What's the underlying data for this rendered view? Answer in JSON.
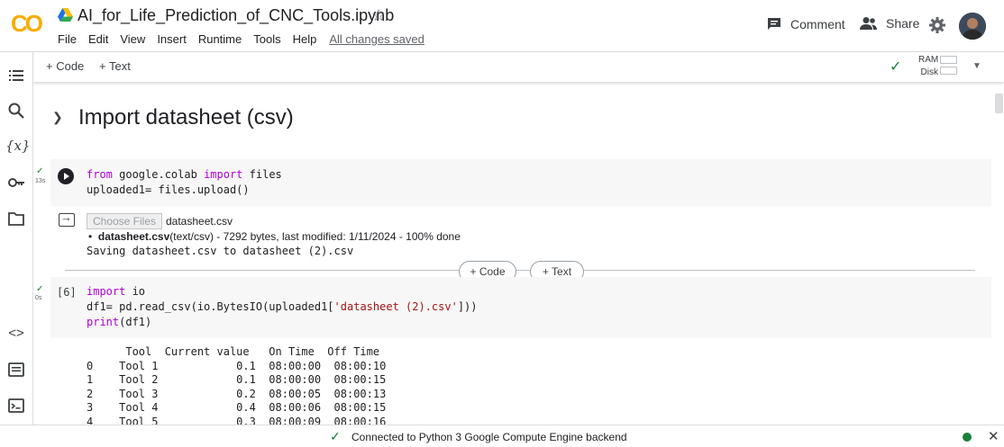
{
  "header": {
    "logo_text": "CO",
    "notebook_title": "AI_for_Life_Prediction_of_CNC_Tools.ipynb",
    "menu": [
      "File",
      "Edit",
      "View",
      "Insert",
      "Runtime",
      "Tools",
      "Help"
    ],
    "save_status": "All changes saved",
    "comment_label": "Comment",
    "share_label": "Share"
  },
  "toolbar": {
    "add_code_label": "+ Code",
    "add_text_label": "+ Text",
    "ram_label": "RAM",
    "disk_label": "Disk"
  },
  "section": {
    "title": "Import datasheet (csv)"
  },
  "cell1": {
    "exec_time": "13s",
    "output": {
      "choose_files_label": "Choose Files",
      "chosen_file": "datasheet.csv",
      "upload_filename": "datasheet.csv",
      "upload_detail": "(text/csv) - 7292 bytes, last modified: 1/11/2024 - 100% done",
      "saving_line": "Saving datasheet.csv to datasheet (2).csv"
    }
  },
  "between_cells": {
    "add_code_label": "+ Code",
    "add_text_label": "+ Text"
  },
  "cell2": {
    "exec_count": "[6]",
    "exec_time": "0s",
    "output_lines": [
      "      Tool  Current value   On Time  Off Time",
      "0    Tool 1            0.1  08:00:00  08:00:10",
      "1    Tool 2            0.1  08:00:00  08:00:15",
      "2    Tool 3            0.2  08:00:05  08:00:13",
      "3    Tool 4            0.4  08:00:06  08:00:15",
      "4    Tool 5            0.3  08:00:09  08:00:16"
    ]
  },
  "statusbar": {
    "message": "Connected to Python 3 Google Compute Engine backend"
  },
  "colors": {
    "accent_orange": "#f9ab00",
    "success_green": "#188038",
    "keyword_purple": "#af00db",
    "string_red": "#a31515"
  }
}
